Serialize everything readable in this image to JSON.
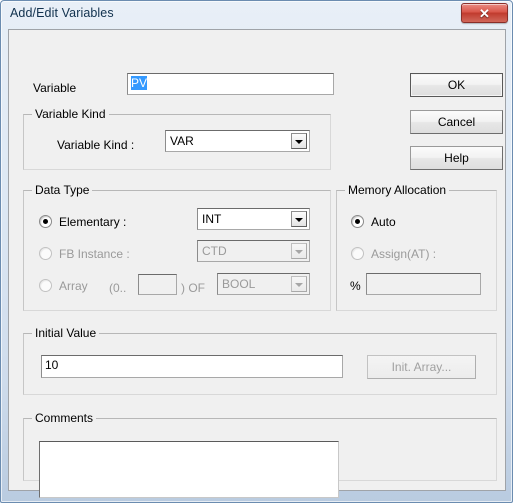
{
  "window": {
    "title": "Add/Edit Variables",
    "close_glyph": "✕"
  },
  "variable": {
    "label": "Variable",
    "value": "PV",
    "placeholder": ""
  },
  "buttons": {
    "ok": "OK",
    "cancel": "Cancel",
    "help": "Help",
    "init_array": "Init. Array..."
  },
  "variable_kind": {
    "group_title": "Variable Kind",
    "field_label": "Variable Kind :",
    "value": "VAR"
  },
  "data_type": {
    "group_title": "Data Type",
    "elementary": {
      "label": "Elementary :",
      "value": "INT"
    },
    "fb_instance": {
      "label": "FB Instance :",
      "value": "CTD"
    },
    "array": {
      "label": "Array",
      "range_prefix": "(0..",
      "range_value": "",
      "range_suffix": ") OF",
      "value": "BOOL"
    }
  },
  "memory_allocation": {
    "group_title": "Memory Allocation",
    "auto_label": "Auto",
    "assign_label": "Assign(AT) :",
    "percent_label": "%",
    "address_value": ""
  },
  "initial_value": {
    "group_title": "Initial Value",
    "value": "10"
  },
  "comments": {
    "group_title": "Comments",
    "value": ""
  },
  "colors": {
    "selection": "#3399ff",
    "close_button": "#c03a2d",
    "dialog_face": "#f0f0f0",
    "title_text": "#11314e"
  }
}
